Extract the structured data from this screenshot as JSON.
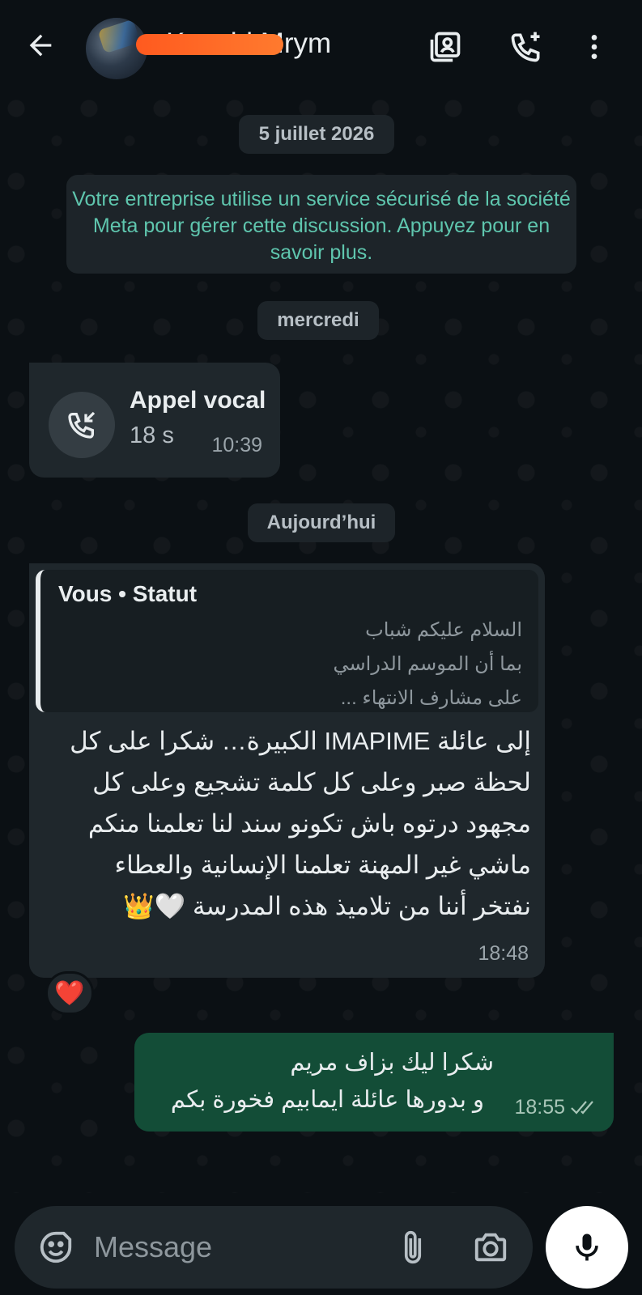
{
  "header": {
    "contact_name": "Kenchi Mrym",
    "icons": [
      "back-arrow-icon",
      "contacts-book-icon",
      "add-call-icon",
      "more-vertical-icon"
    ]
  },
  "chat": {
    "date_1": "5 juillet 2026",
    "system_message": "Votre entreprise utilise un service sécurisé de la société Meta pour gérer cette discussion. Appuyez pour en savoir plus.",
    "date_2": "mercredi",
    "call": {
      "title": "Appel vocal",
      "duration": "18 s",
      "time": "10:39"
    },
    "date_3": "Aujourd’hui",
    "status_message": {
      "quote_title": "Vous • Statut",
      "quote_lines": [
        "السلام عليكم شباب",
        "بما أن الموسم الدراسي",
        "على مشارف الانتهاء ..."
      ],
      "body": "إلى عائلة IMAPIME الكبيرة… شكرا على كل لحظة صبر وعلى كل كلمة تشجيع وعلى كل مجهود درتوه باش تكونو سند لنا تعلمنا منكم ماشي غير المهنة تعلمنا الإنسانية والعطاء نفتخر أننا من تلاميذ هذه المدرسة 🤍👑",
      "time": "18:48",
      "reaction": "❤️"
    },
    "outgoing": {
      "line1": "شكرا ليك بزاف مريم",
      "line2": "و بدورها عائلة ايمابيم فخورة بكم",
      "time": "18:55"
    }
  },
  "input": {
    "placeholder": "Message"
  },
  "colors": {
    "background": "#0b1014",
    "incoming_bubble": "#1f272c",
    "outgoing_bubble": "#134d37",
    "system_text": "#5fc6ae"
  }
}
